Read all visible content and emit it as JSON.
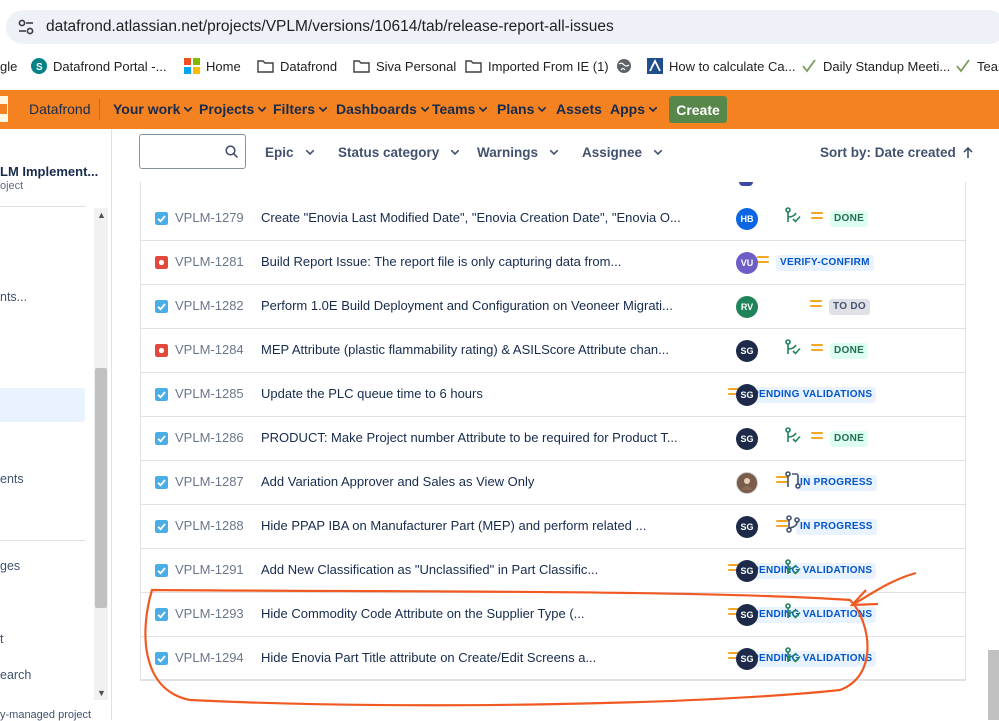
{
  "browser": {
    "url": "datafrond.atlassian.net/projects/VPLM/versions/10614/tab/release-report-all-issues"
  },
  "bookmarks": [
    {
      "label": "gle",
      "icon": "google-icon"
    },
    {
      "label": "Datafrond Portal -...",
      "icon": "sharepoint-icon"
    },
    {
      "label": "Home",
      "icon": "microsoft-icon"
    },
    {
      "label": "Datafrond",
      "icon": "folder-icon"
    },
    {
      "label": "Siva Personal",
      "icon": "folder-icon"
    },
    {
      "label": "Imported From IE (1)",
      "icon": "folder-icon"
    },
    {
      "label": "",
      "icon": "globe-icon"
    },
    {
      "label": "How to calculate Ca...",
      "icon": "site-icon"
    },
    {
      "label": "Daily Standup Meeti...",
      "icon": "check-icon"
    },
    {
      "label": "Tean",
      "icon": "check-icon"
    }
  ],
  "nav": {
    "site": "Datafrond",
    "items": [
      "Your work",
      "Projects",
      "Filters",
      "Dashboards",
      "Teams",
      "Plans",
      "Assets",
      "Apps"
    ],
    "create": "Create"
  },
  "sidebar": {
    "project_name": "LM Implement...",
    "project_type": "oject",
    "items": [
      "nts...",
      "ents",
      "ges",
      "t",
      "earch"
    ],
    "footer": "y-managed project"
  },
  "filters": {
    "search_placeholder": "",
    "epic": "Epic",
    "status_category": "Status category",
    "warnings": "Warnings",
    "assignee": "Assignee",
    "sort_by": "Sort by: Date created"
  },
  "issues": [
    {
      "type": "task",
      "key": "VPLM-1279",
      "summary": "Create \"Enovia Last Modified Date\", \"Enovia Creation Date\", \"Enovia O...",
      "status": "DONE",
      "status_kind": "done",
      "assignee": "HB",
      "avatar_color": "#0c66e4",
      "dev": "branch-done"
    },
    {
      "type": "bug",
      "key": "VPLM-1281",
      "summary": "Build Report Issue: The report file is only capturing data from...",
      "status": "VERIFY-CONFIRM",
      "status_kind": "blue",
      "assignee": "VU",
      "avatar_color": "#6e5dc6",
      "dev": ""
    },
    {
      "type": "task",
      "key": "VPLM-1282",
      "summary": "Perform 1.0E Build Deployment and Configuration on Veoneer Migrati...",
      "status": "TO DO",
      "status_kind": "todo",
      "assignee": "RV",
      "avatar_color": "#1f845a",
      "dev": ""
    },
    {
      "type": "bug",
      "key": "VPLM-1284",
      "summary": "MEP Attribute (plastic flammability rating) & ASILScore Attribute chan...",
      "status": "DONE",
      "status_kind": "done",
      "assignee": "SG",
      "avatar_color": "#1d2a4a",
      "dev": "branch-done"
    },
    {
      "type": "task",
      "key": "VPLM-1285",
      "summary": "Update the PLC queue time to 6 hours",
      "status": "PENDING VALIDATIONS",
      "status_kind": "blue",
      "assignee": "SG",
      "avatar_color": "#1d2a4a",
      "dev": ""
    },
    {
      "type": "task",
      "key": "VPLM-1286",
      "summary": "PRODUCT: Make Project number Attribute to be required for Product T...",
      "status": "DONE",
      "status_kind": "done",
      "assignee": "SG",
      "avatar_color": "#1d2a4a",
      "dev": "branch-done"
    },
    {
      "type": "task",
      "key": "VPLM-1287",
      "summary": "Add Variation Approver and Sales as View Only",
      "status": "IN PROGRESS",
      "status_kind": "blue",
      "assignee": "",
      "avatar_color": "#7a5c4a",
      "dev": "pull-request"
    },
    {
      "type": "task",
      "key": "VPLM-1288",
      "summary": "Hide PPAP IBA on Manufacturer Part (MEP) and perform related ...",
      "status": "IN PROGRESS",
      "status_kind": "blue",
      "assignee": "SG",
      "avatar_color": "#1d2a4a",
      "dev": "branch"
    },
    {
      "type": "task",
      "key": "VPLM-1291",
      "summary": "Add New Classification as \"Unclassified\" in Part Classific...",
      "status": "PENDING VALIDATIONS",
      "status_kind": "blue",
      "assignee": "SG",
      "avatar_color": "#1d2a4a",
      "dev": "branch-done"
    },
    {
      "type": "task",
      "key": "VPLM-1293",
      "summary": "Hide Commodity Code Attribute on the Supplier Type (...",
      "status": "PENDING VALIDATIONS",
      "status_kind": "blue",
      "assignee": "SG",
      "avatar_color": "#1d2a4a",
      "dev": "branch-done"
    },
    {
      "type": "task",
      "key": "VPLM-1294",
      "summary": "Hide Enovia Part Title attribute on Create/Edit Screens a...",
      "status": "PENDING VALIDATIONS",
      "status_kind": "blue",
      "assignee": "SG",
      "avatar_color": "#1d2a4a",
      "dev": "branch-done"
    }
  ],
  "colors": {
    "nav_bg": "#f58220",
    "create_button": "#57874a",
    "annotation": "#f05a22",
    "priority_medium": "#f5a623"
  }
}
